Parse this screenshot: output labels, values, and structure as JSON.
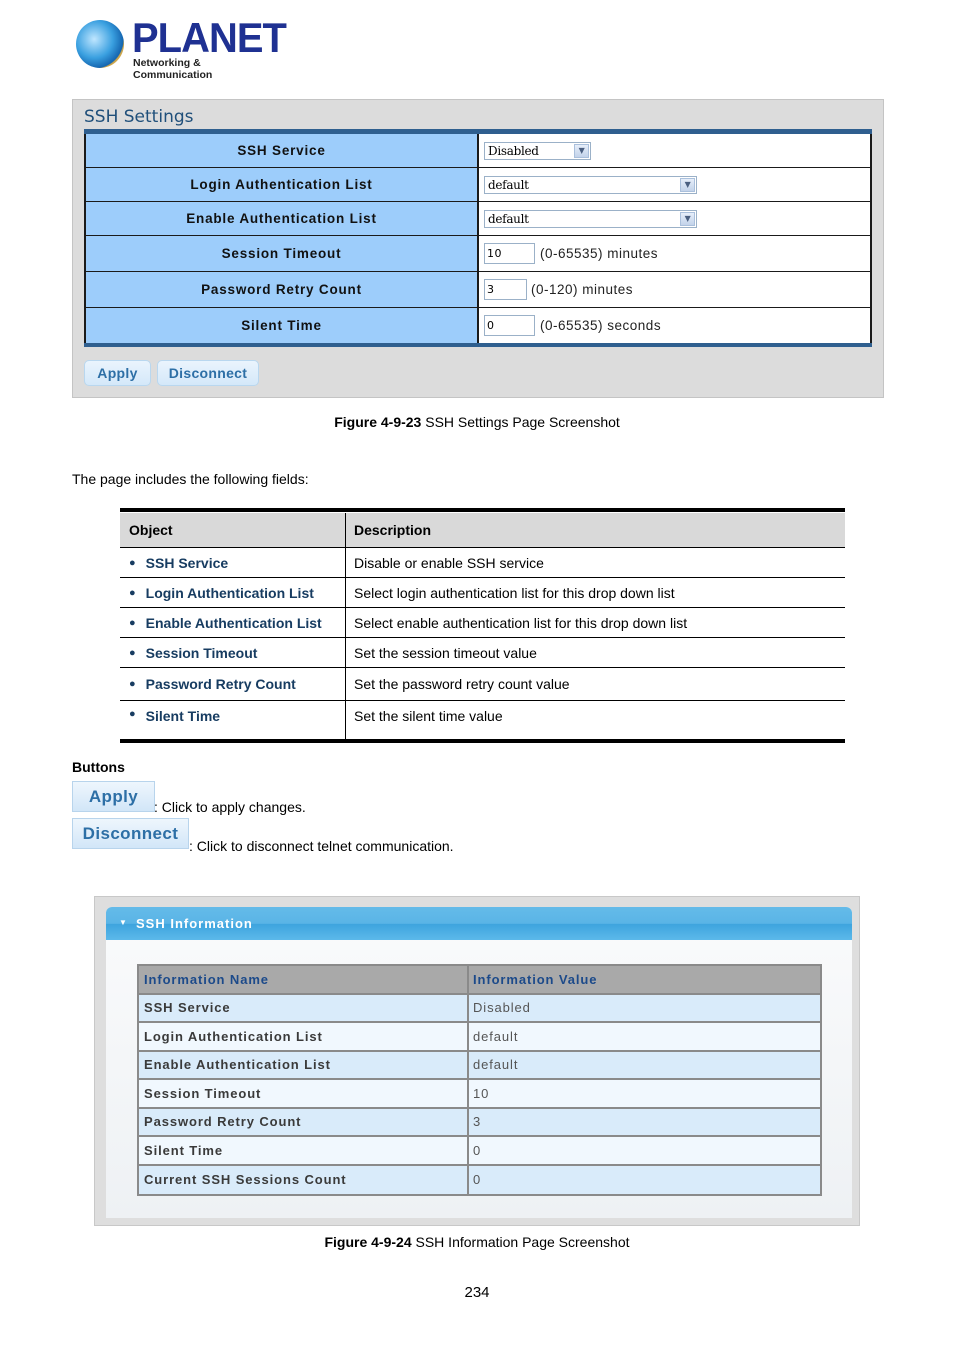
{
  "logo": {
    "brand": "PLANET",
    "tagline": "Networking & Communication",
    "icon": "globe-icon"
  },
  "ssh_settings": {
    "title": "SSH Settings",
    "rows": [
      {
        "label": "SSH Service",
        "type": "select",
        "value": "Disabled"
      },
      {
        "label": "Login Authentication List",
        "type": "select",
        "value": "default"
      },
      {
        "label": "Enable Authentication List",
        "type": "select",
        "value": "default"
      },
      {
        "label": "Session Timeout",
        "type": "text",
        "value": "10",
        "hint": "(0-65535) minutes"
      },
      {
        "label": "Password Retry Count",
        "type": "text",
        "value": "3",
        "hint": "(0-120) minutes"
      },
      {
        "label": "Silent Time",
        "type": "text",
        "value": "0",
        "hint": "(0-65535) seconds"
      }
    ],
    "apply_label": "Apply",
    "disconnect_label": "Disconnect"
  },
  "figure1": {
    "number": "Figure 4-9-23",
    "text": " SSH Settings Page Screenshot"
  },
  "intro": "The page includes the following fields:",
  "desc_table": {
    "headers": [
      "Object",
      "Description"
    ],
    "rows": [
      {
        "object": "SSH Service",
        "description": "Disable or enable SSH service"
      },
      {
        "object": "Login Authentication List",
        "description": "Select login authentication list for this drop down list"
      },
      {
        "object": "Enable Authentication List",
        "description": "Select enable authentication list for this drop down list"
      },
      {
        "object": "Session Timeout",
        "description": "Set the session timeout value"
      },
      {
        "object": "Password Retry Count",
        "description": "Set the password retry count value"
      },
      {
        "object": "Silent Time",
        "description": "Set the silent time value"
      }
    ]
  },
  "buttons_section": {
    "heading": "Buttons",
    "apply_label": "Apply",
    "apply_desc": ": Click to apply changes.",
    "disconnect_label": "Disconnect",
    "disconnect_desc": ": Click to disconnect telnet communication."
  },
  "ssh_information": {
    "title": "SSH Information",
    "headers": [
      "Information Name",
      "Information Value"
    ],
    "rows": [
      {
        "name": "SSH Service",
        "value": "Disabled"
      },
      {
        "name": "Login Authentication List",
        "value": "default"
      },
      {
        "name": "Enable Authentication List",
        "value": "default"
      },
      {
        "name": "Session Timeout",
        "value": "10"
      },
      {
        "name": "Password Retry Count",
        "value": "3"
      },
      {
        "name": "Silent Time",
        "value": "0"
      },
      {
        "name": "Current SSH Sessions Count",
        "value": "0"
      }
    ]
  },
  "figure2": {
    "number": "Figure 4-9-24",
    "text": " SSH Information Page Screenshot"
  },
  "page_number": "234",
  "colors": {
    "label_bg": "#9dcdfb",
    "table_border": "#2f5f8f",
    "button_text": "#2d6fa6",
    "header_blue": "#5ab4e6",
    "object_text": "#173c61"
  }
}
